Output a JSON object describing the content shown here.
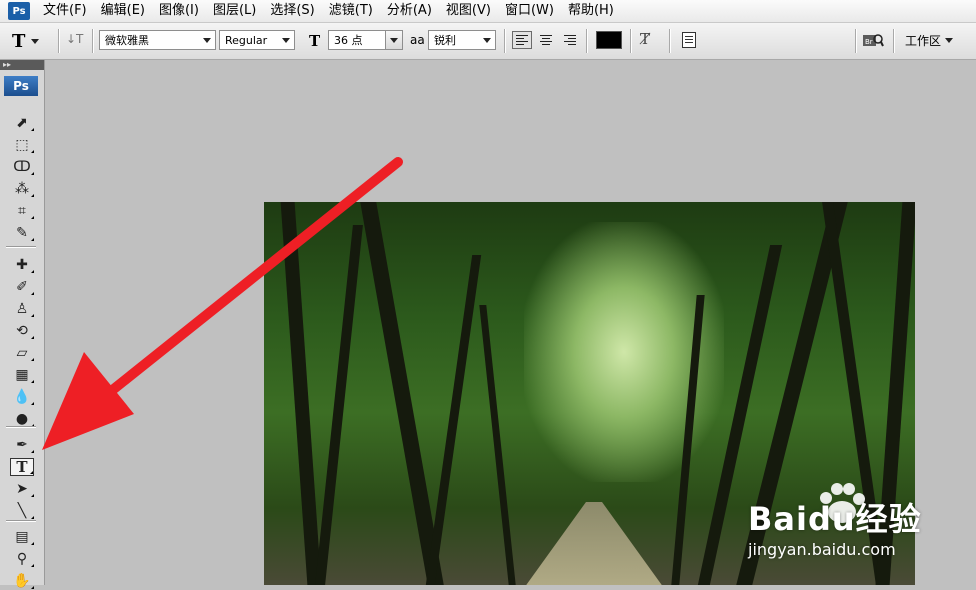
{
  "menubar": {
    "logo": "Ps",
    "items": [
      "文件(F)",
      "编辑(E)",
      "图像(I)",
      "图层(L)",
      "选择(S)",
      "滤镜(T)",
      "分析(A)",
      "视图(V)",
      "窗口(W)",
      "帮助(H)"
    ]
  },
  "options": {
    "tool_icon": "T",
    "orientation_icon": "text-orientation-icon",
    "font_family": "微软雅黑",
    "font_style": "Regular",
    "font_size": "36 点",
    "antialias_icon_label": "aa",
    "antialias": "锐利",
    "text_color": "#000000",
    "workspace": "工作区"
  },
  "toolbox": {
    "logo": "Ps",
    "tools": [
      {
        "name": "move-tool",
        "glyph": "⬈"
      },
      {
        "name": "marquee-tool",
        "glyph": "⬚"
      },
      {
        "name": "lasso-tool",
        "glyph": "ↀ"
      },
      {
        "name": "magic-wand-tool",
        "glyph": "⁂"
      },
      {
        "name": "crop-tool",
        "glyph": "⌗"
      },
      {
        "name": "eyedropper-slice-tool",
        "glyph": "✎"
      },
      {
        "name": "healing-brush-tool",
        "glyph": "✚"
      },
      {
        "name": "brush-tool",
        "glyph": "✐"
      },
      {
        "name": "clone-stamp-tool",
        "glyph": "♙"
      },
      {
        "name": "history-brush-tool",
        "glyph": "⟲"
      },
      {
        "name": "eraser-tool",
        "glyph": "▱"
      },
      {
        "name": "gradient-tool",
        "glyph": "▦"
      },
      {
        "name": "blur-tool",
        "glyph": "💧"
      },
      {
        "name": "dodge-tool",
        "glyph": "●"
      },
      {
        "name": "pen-tool",
        "glyph": "✒"
      },
      {
        "name": "type-tool",
        "glyph": "T"
      },
      {
        "name": "path-selection-tool",
        "glyph": "➤"
      },
      {
        "name": "line-tool",
        "glyph": "╲"
      },
      {
        "name": "notes-tool",
        "glyph": "▤"
      },
      {
        "name": "eyedropper-tool",
        "glyph": "⚲"
      },
      {
        "name": "hand-tool",
        "glyph": "✋"
      }
    ]
  },
  "accent_colors": {
    "arrow": "#ee1f25",
    "ps_blue": "#1c5aa6"
  },
  "watermark": {
    "brand": "Baidu经验",
    "url": "jingyan.baidu.com"
  }
}
